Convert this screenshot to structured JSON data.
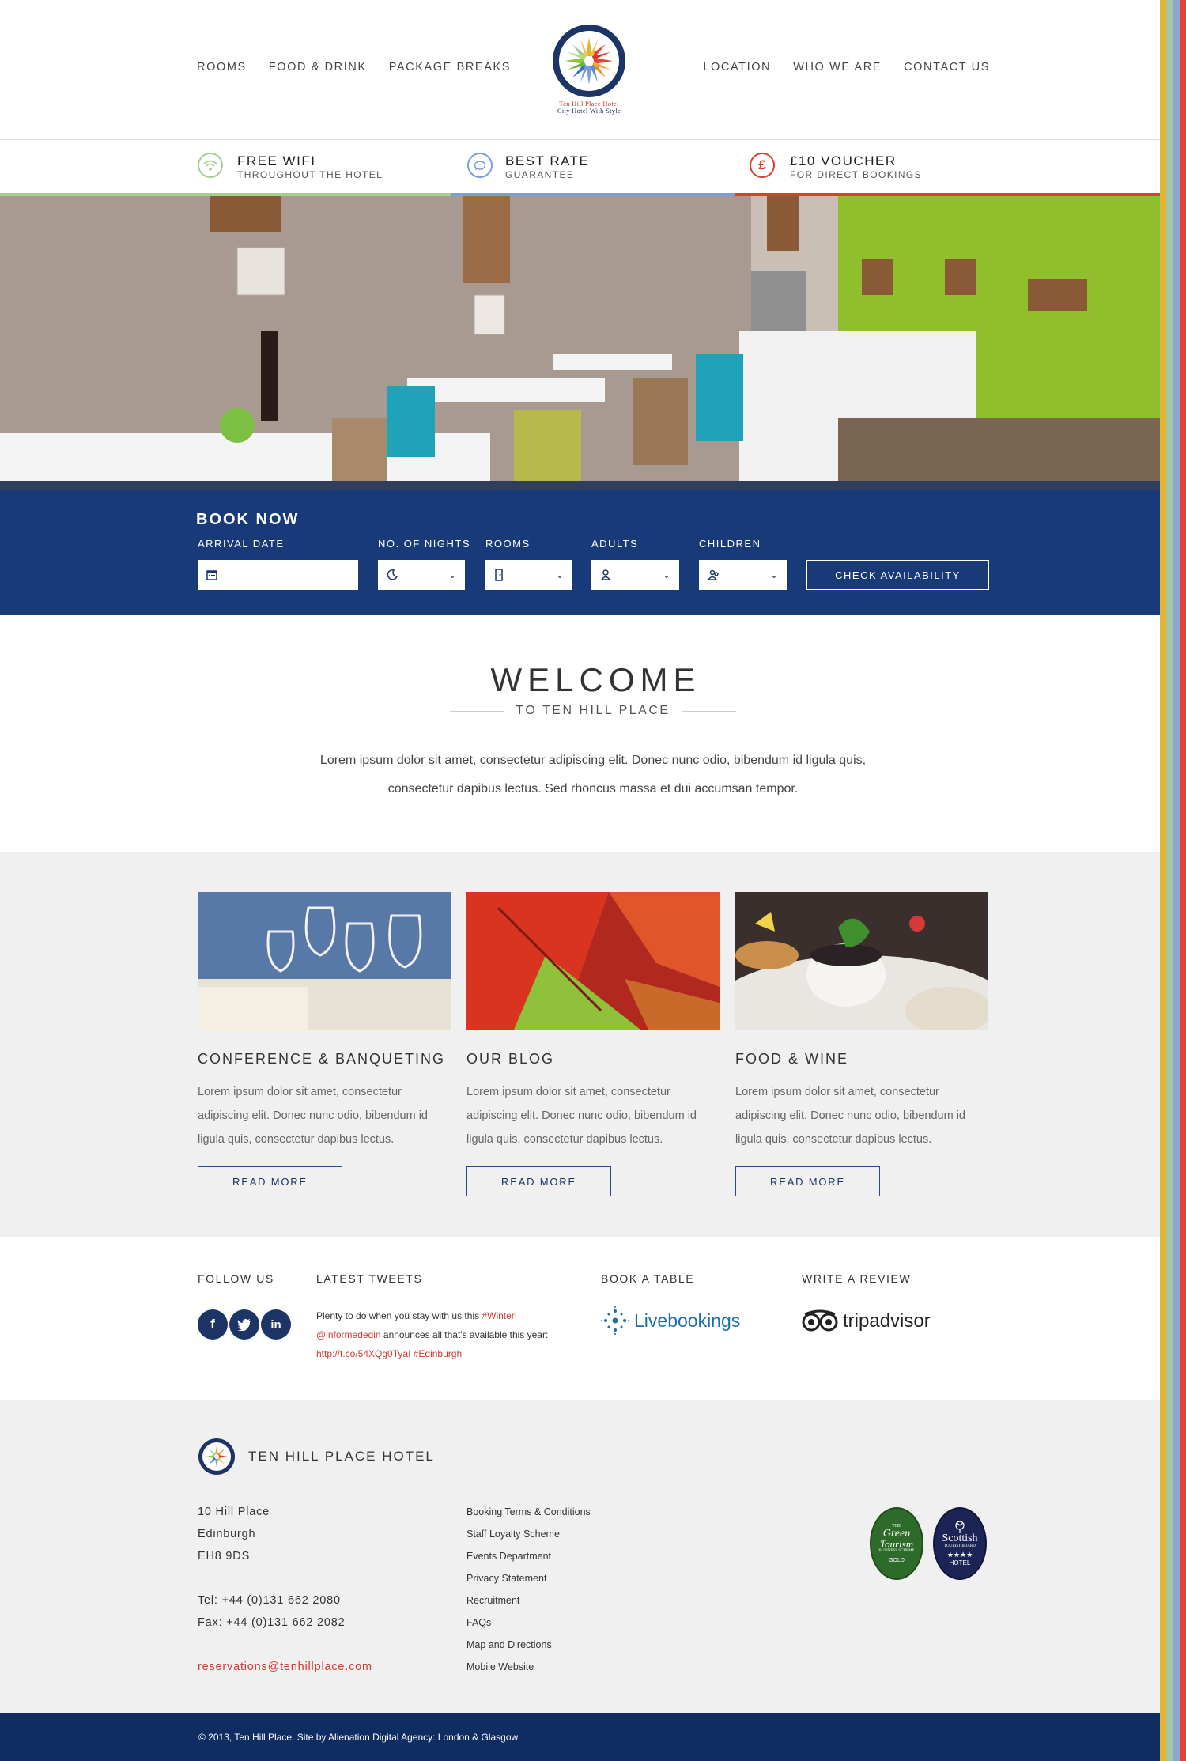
{
  "colors": {
    "navy": "#1c3466",
    "green": "#a4cf8e",
    "blue": "#7a9fd6",
    "red": "#e53b2a",
    "stripes": [
      "#e1b433",
      "#a3c6a6",
      "#8aa7d2",
      "#e84133"
    ]
  },
  "nav": {
    "left": [
      "ROOMS",
      "FOOD & DRINK",
      "PACKAGE BREAKS"
    ],
    "right": [
      "LOCATION",
      "WHO WE ARE",
      "CONTACT US"
    ]
  },
  "logo": {
    "line1": "Ten Hill Place Hotel",
    "line2": "City Hotel With Style"
  },
  "features": [
    {
      "title": "FREE WIFI",
      "subtitle": "THROUGHOUT THE HOTEL",
      "icon": "wifi-icon"
    },
    {
      "title": "BEST RATE",
      "subtitle": "GUARANTEE",
      "icon": "piggy-bank-icon"
    },
    {
      "title": "£10 VOUCHER",
      "subtitle": "FOR DIRECT BOOKINGS",
      "icon": "pound-icon"
    }
  ],
  "booking": {
    "title": "BOOK NOW",
    "arrival_label": "ARRIVAL DATE",
    "nights_label": "NO. OF NIGHTS",
    "rooms_label": "ROOMS",
    "adults_label": "ADULTS",
    "children_label": "CHILDREN",
    "check_label": "CHECK AVAILABILITY"
  },
  "welcome": {
    "title": "WELCOME",
    "subtitle": "TO TEN HILL PLACE",
    "text": "Lorem ipsum dolor sit amet, consectetur adipiscing elit. Donec nunc odio, bibendum id ligula quis, consectetur dapibus lectus. Sed rhoncus massa et dui accumsan tempor."
  },
  "cards": [
    {
      "title": "CONFERENCE & BANQUETING",
      "text": "Lorem ipsum dolor sit amet, consectetur adipiscing elit. Donec nunc odio, bibendum id ligula quis, consectetur dapibus lectus.",
      "button": "READ MORE"
    },
    {
      "title": "OUR BLOG",
      "text": "Lorem ipsum dolor sit amet, consectetur adipiscing elit. Donec nunc odio, bibendum id ligula quis, consectetur dapibus lectus.",
      "button": "READ MORE"
    },
    {
      "title": "FOOD & WINE",
      "text": "Lorem ipsum dolor sit amet, consectetur adipiscing elit. Donec nunc odio, bibendum id ligula quis, consectetur dapibus lectus.",
      "button": "READ MORE"
    }
  ],
  "social": {
    "follow": "FOLLOW US",
    "tweets": "LATEST TWEETS",
    "table": "BOOK A TABLE",
    "review": "WRITE A REVIEW",
    "tweet_a": "Plenty to do when you stay with us this ",
    "tweet_tag1": "#Winter",
    "tweet_b": "!",
    "tweet_handle": "@informededin",
    "tweet_c": " announces all that's available this year:",
    "tweet_link": "http://t.co/54XQg0TyaI #Edinburgh",
    "livebookings": "Livebookings",
    "tripadvisor": "tripadvisor"
  },
  "footer": {
    "brand": "TEN HILL PLACE HOTEL",
    "address": [
      "10 Hill Place",
      "Edinburgh",
      "EH8 9DS"
    ],
    "tel": "Tel: +44 (0)131 662 2080",
    "fax": "Fax: +44 (0)131 662 2082",
    "email": "reservations@tenhillplace.com",
    "links": [
      "Booking Terms & Conditions",
      "Staff Loyalty Scheme",
      "Events Department",
      "Privacy Statement",
      "Recruitment",
      "FAQs",
      "Map and Directions",
      "Mobile Website"
    ],
    "badge1": {
      "l1": "THE",
      "l2": "Green",
      "l3": "Tourism",
      "l4": "BUSINESS SCHEME",
      "l5": "GOLD"
    },
    "badge2": {
      "l1": "Scottish",
      "l2": "TOURIST BOARD",
      "l3": "★★★★",
      "l4": "HOTEL"
    },
    "copyright": "© 2013, Ten Hill Place. Site by Alienation Digital Agency: London & Glasgow"
  }
}
